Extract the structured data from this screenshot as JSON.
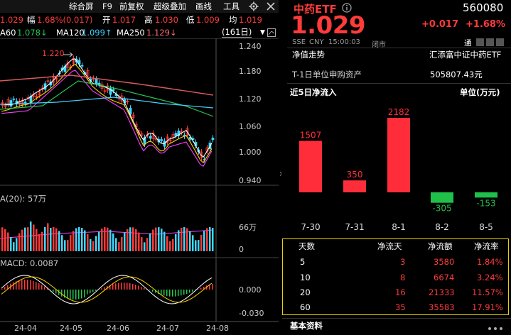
{
  "toolbar": {
    "menu": [
      "综合屏",
      "F9",
      "前复权",
      "超级叠加",
      "画线",
      "工具"
    ],
    "settings_icon": "gear-icon",
    "close_icon": "close-icon"
  },
  "quote_bar": {
    "price": "1.029",
    "amp_label": "幅",
    "amp_value": "1.68%(0.017)",
    "open_label": "开",
    "open_value": "1.017",
    "high_label": "高",
    "high_value": "1.030",
    "low_label": "低",
    "low_value": "1.009",
    "avg_label": "均",
    "avg_value": "1.019"
  },
  "ma_bar": {
    "ma60_label": "A60",
    "ma60_value": "1.078↓",
    "ma120_label": "MA120",
    "ma120_value": "1.099↑",
    "ma250_label": "MA250",
    "ma250_value": "1.129↓",
    "period": "(161日)",
    "period_arrow": "▼"
  },
  "price_axis": [
    "1.240",
    "1.180",
    "1.120",
    "1.060",
    "1.000",
    "0.940"
  ],
  "high_annotation": "1.220",
  "volume_label": "A(20): 57万",
  "volume_axis": [
    "66万",
    "0"
  ],
  "macd_label": "MACD: 0.0087",
  "macd_axis": [
    "0.000",
    "-0.030"
  ],
  "date_axis": [
    "24-04",
    "24-05",
    "24-06",
    "24-07",
    "24-08"
  ],
  "header": {
    "name": "中药ETF",
    "code": "560080",
    "price": "1.029",
    "change": "+0.017",
    "change_pct": "+1.68%",
    "exchange": "SSE",
    "currency": "CNY",
    "time": "15:00:03",
    "status": "闭市",
    "tag": "通",
    "info_icon": "info-icon"
  },
  "nav_trend": {
    "label": "净值走势",
    "fund_name": "汇添富中证中药ETF"
  },
  "prev_asset": {
    "label": "T-1日单位申购资产",
    "value": "505807.43元"
  },
  "flow": {
    "title": "近5日净流入",
    "unit": "单位(万元)",
    "colors": {
      "inflow": "#ff2d3a",
      "outflow": "#1fbf4a"
    }
  },
  "chart_data": {
    "type": "bar",
    "categories": [
      "7-30",
      "7-31",
      "8-1",
      "8-2",
      "8-5"
    ],
    "values": [
      1507,
      350,
      2182,
      -305,
      -153
    ],
    "title": "近5日净流入",
    "ylabel": "单位(万元)"
  },
  "flow_table": {
    "headers": [
      "天数",
      "净流天",
      "净流额",
      "净流率"
    ],
    "rows": [
      [
        "5",
        "3",
        "3580",
        "1.84%"
      ],
      [
        "10",
        "8",
        "6674",
        "3.24%"
      ],
      [
        "20",
        "16",
        "21333",
        "11.57%"
      ],
      [
        "60",
        "35",
        "35583",
        "17.91%"
      ]
    ]
  },
  "basic_info": {
    "label": "基本资料"
  },
  "expand_arrow": "»"
}
